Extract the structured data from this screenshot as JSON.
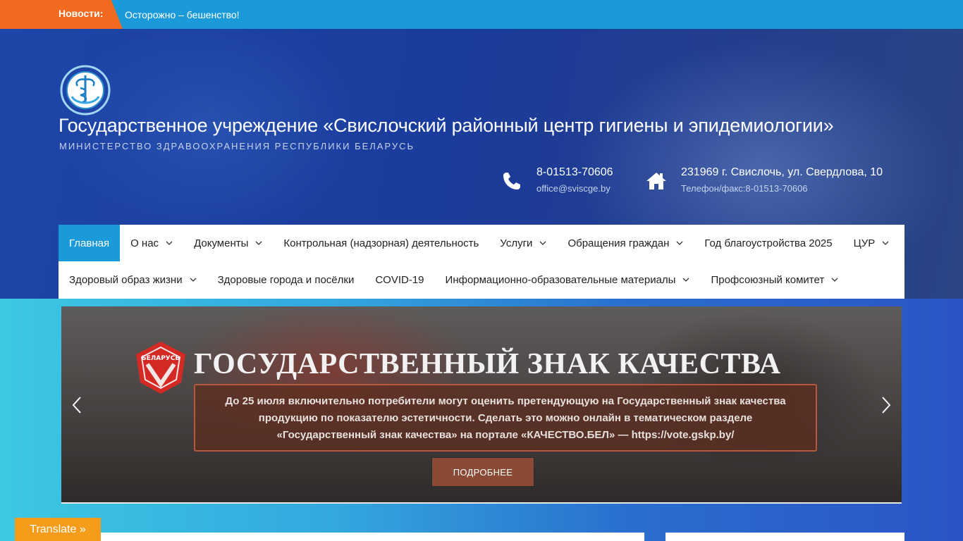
{
  "ticker": {
    "label": "Новости:",
    "text": "Осторожно – бешенство!"
  },
  "header": {
    "title": "Государственное учреждение «Свислочский районный центр гигиены и эпидемиологии»",
    "subtitle": "МИНИСТЕРСТВО ЗДРАВООХРАНЕНИЯ РЕСПУБЛИКИ БЕЛАРУСЬ",
    "phone": {
      "main": "8-01513-70606",
      "sub": "office@sviscge.by",
      "icon": "phone-icon"
    },
    "address": {
      "main": "231969 г. Свислочь, ул. Свердлова, 10",
      "sub": "Телефон/факс:8-01513-70606",
      "icon": "home-icon"
    }
  },
  "nav": {
    "row1": [
      {
        "label": "Главная",
        "active": true
      },
      {
        "label": "О нас",
        "dropdown": true
      },
      {
        "label": "Документы",
        "dropdown": true
      },
      {
        "label": "Контрольная (надзорная) деятельность"
      },
      {
        "label": "Услуги",
        "dropdown": true
      },
      {
        "label": "Обращения граждан",
        "dropdown": true
      },
      {
        "label": "Год благоустройства 2025"
      },
      {
        "label": "ЦУР",
        "dropdown": true
      }
    ],
    "row2": [
      {
        "label": "Здоровый образ жизни",
        "dropdown": true
      },
      {
        "label": "Здоровые города и посёлки"
      },
      {
        "label": "COVID-19"
      },
      {
        "label": "Информационно-образовательные материалы",
        "dropdown": true
      },
      {
        "label": "Профсоюзный комитет",
        "dropdown": true
      }
    ]
  },
  "slider": {
    "title": "ГОСУДАРСТВЕННЫЙ ЗНАК КАЧЕСТВА",
    "badge_text": "БЕЛАРУСЬ",
    "text_lines": [
      "До 25 июля включительно потребители могут оценить претендующую на Государственный знак качества",
      "продукцию по показателю эстетичности. Сделать это можно онлайн в тематическом разделе",
      "«Государственный знак качества» на портале «КАЧЕСТВО.БЕЛ» — https://vote.gskp.by/"
    ],
    "button": "ПОДРОБНЕЕ"
  },
  "translate": {
    "label": "Translate »"
  },
  "colors": {
    "accent": "#1a9ad9",
    "ticker_label": "#f26a1f",
    "translate": "#f59c1a",
    "header_bg": "#1e45a8"
  }
}
